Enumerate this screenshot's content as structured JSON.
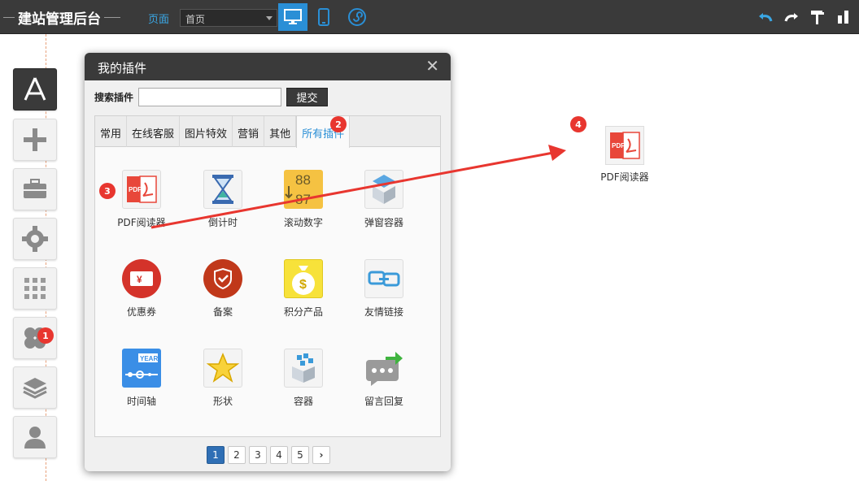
{
  "app": {
    "title": "建站管理后台"
  },
  "topbar": {
    "page_label": "页面",
    "page_select_value": "首页"
  },
  "dialog": {
    "title": "我的插件",
    "search_label": "搜索插件",
    "search_value": "",
    "submit_label": "提交",
    "tabs": [
      "常用",
      "在线客服",
      "图片特效",
      "营销",
      "其他",
      "所有插件"
    ],
    "active_tab": "所有插件",
    "plugins": [
      {
        "label": "PDF阅读器",
        "icon": "pdf-icon"
      },
      {
        "label": "倒计时",
        "icon": "hourglass-icon"
      },
      {
        "label": "滚动数字",
        "icon": "rolling-number-icon",
        "digits": [
          "88",
          "87"
        ]
      },
      {
        "label": "弹窗容器",
        "icon": "popup-box-icon"
      },
      {
        "label": "优惠券",
        "icon": "coupon-icon",
        "symbol": "¥"
      },
      {
        "label": "备案",
        "icon": "shield-check-icon"
      },
      {
        "label": "积分产品",
        "icon": "money-bag-icon",
        "symbol": "$"
      },
      {
        "label": "友情链接",
        "icon": "link-icon"
      },
      {
        "label": "时间轴",
        "icon": "timeline-icon",
        "tag": "YEAR"
      },
      {
        "label": "形状",
        "icon": "star-icon"
      },
      {
        "label": "容器",
        "icon": "container-box-icon"
      },
      {
        "label": "留言回复",
        "icon": "message-reply-icon"
      }
    ],
    "pager": [
      "1",
      "2",
      "3",
      "4",
      "5"
    ],
    "pager_current": "1"
  },
  "canvas": {
    "dropped_plugin": {
      "label": "PDF阅读器",
      "icon": "pdf-icon"
    }
  },
  "badges": [
    "1",
    "2",
    "3",
    "4"
  ],
  "pdf_text": "PDF",
  "colors": {
    "topbar": "#3a3a3a",
    "accent": "#2a8fd6",
    "badge": "#e8362f",
    "arrow": "#e8362f"
  }
}
